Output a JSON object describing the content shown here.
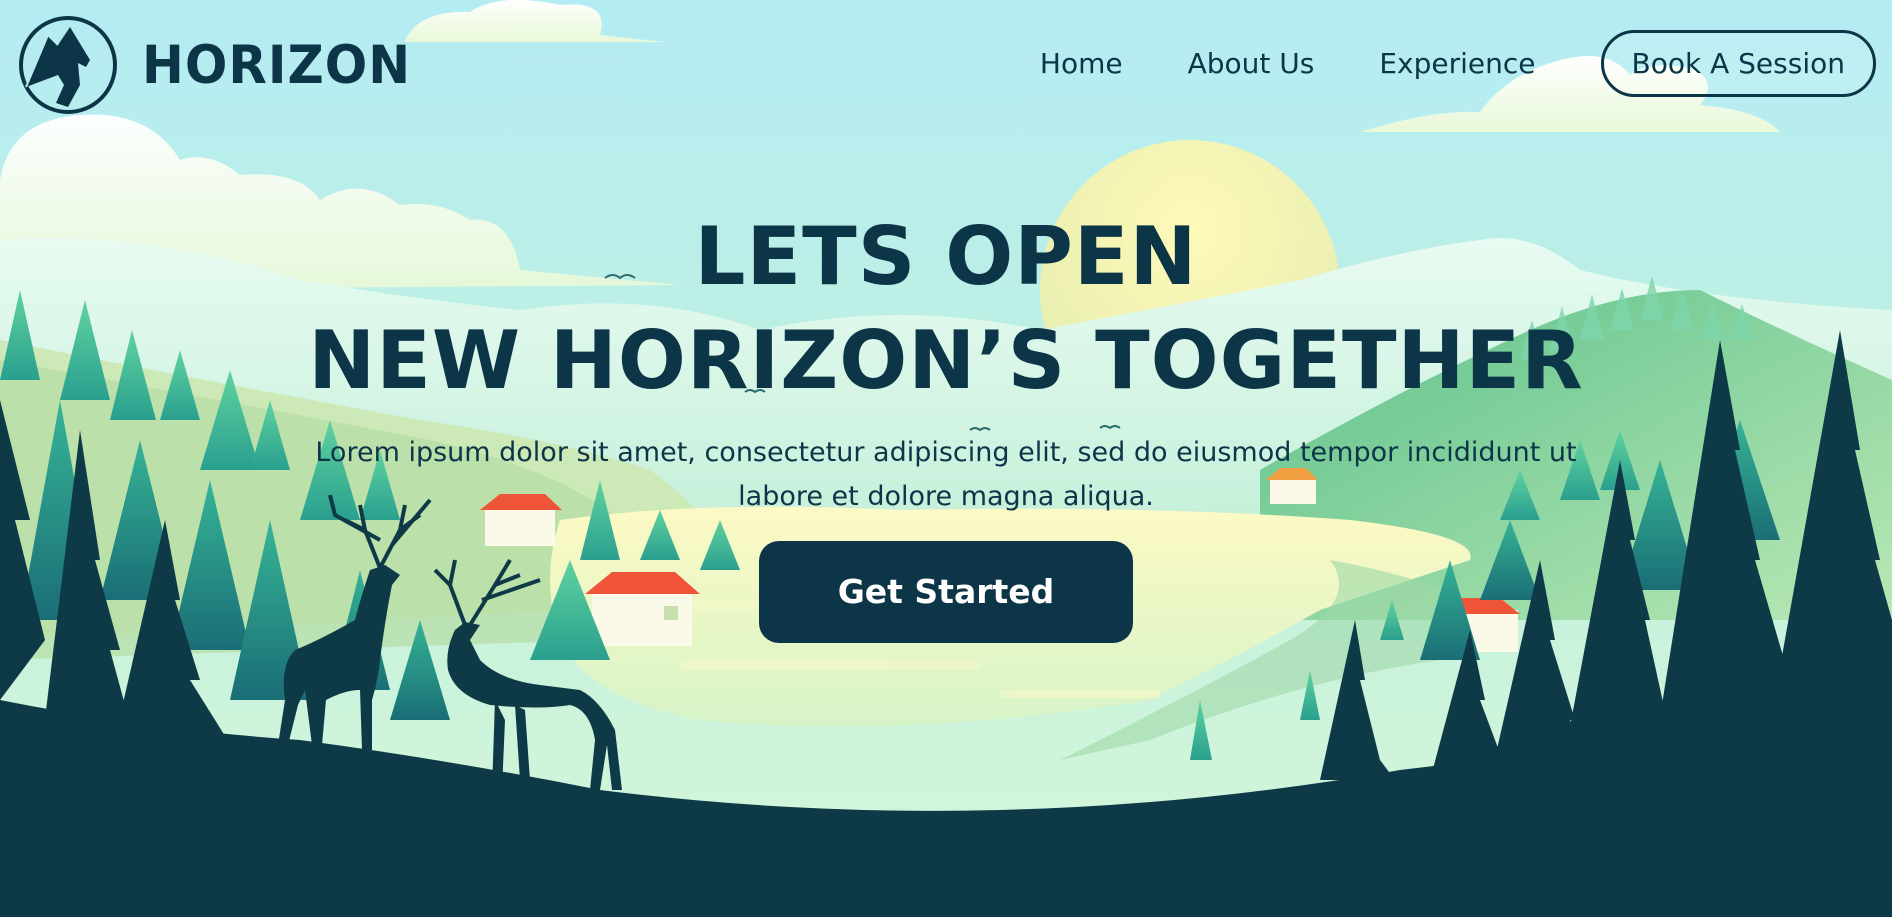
{
  "brand": {
    "name": "HORIZON",
    "logo_icon": "mountain-circle-icon"
  },
  "nav": {
    "links": [
      {
        "label": "Home"
      },
      {
        "label": "About Us"
      },
      {
        "label": "Experience"
      }
    ],
    "cta_label": "Book A Session"
  },
  "hero": {
    "headline_line1": "LETS OPEN",
    "headline_line2": "NEW HORIZON’S TOGETHER",
    "subtext": "Lorem ipsum dolor sit amet, consectetur adipiscing elit, sed do eiusmod tempor incididunt ut labore et dolore magna aliqua.",
    "button_label": "Get Started"
  },
  "colors": {
    "primary_dark": "#0d3548",
    "sky": "#b8ecf2",
    "sun": "#fff7b8",
    "forest_light": "#5fc79a",
    "lake": "#fdf8c8",
    "roof": "#f0553a"
  }
}
